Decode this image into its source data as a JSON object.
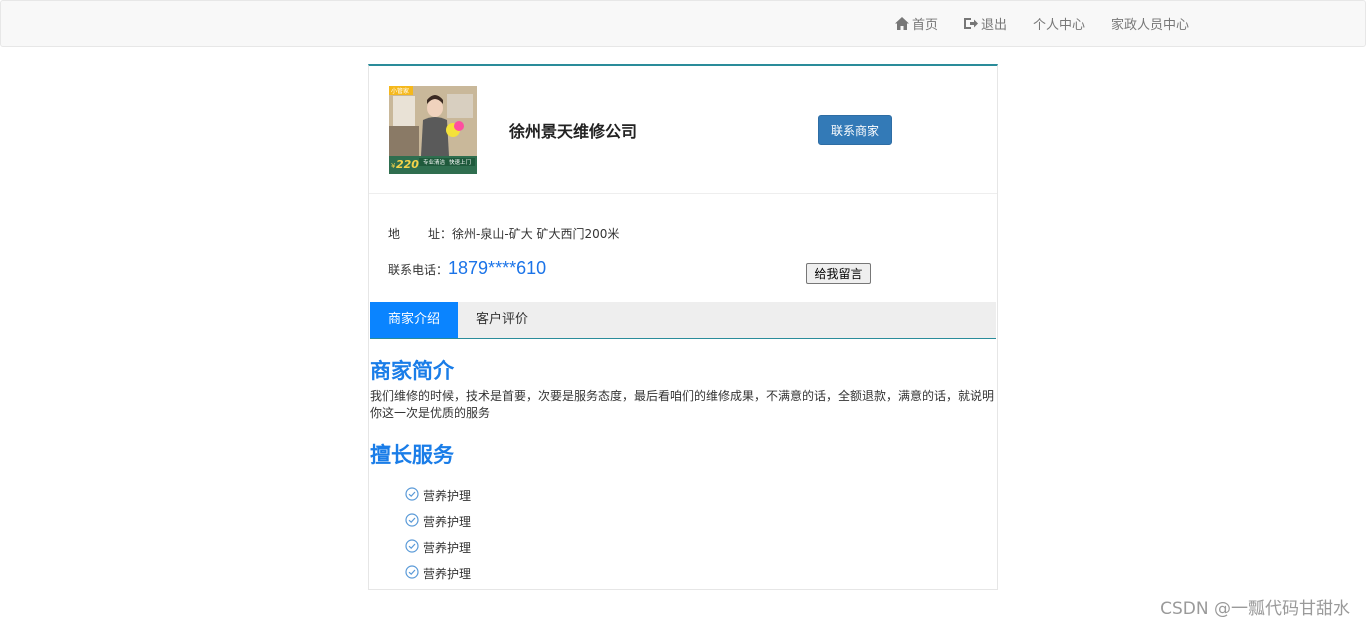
{
  "nav": {
    "home": "首页",
    "logout": "退出",
    "personal_center": "个人中心",
    "staff_center": "家政人员中心"
  },
  "company": {
    "name": "徐州景天维修公司",
    "contact_button": "联系商家",
    "address_label_1": "地",
    "address_label_2": "址：",
    "address": "徐州-泉山-矿大 矿大西门200米",
    "phone_label": "联系电话：",
    "phone": "1879****610",
    "message_button": "给我留言"
  },
  "thumb": {
    "badge": "小管家",
    "price": "220",
    "price_prefix": "¥",
    "caption_1": "专业清洁",
    "caption_2": "快速上门"
  },
  "tabs": [
    "商家介绍",
    "客户评价"
  ],
  "intro": {
    "title": "商家简介",
    "text": "我们维修的时候，技术是首要，次要是服务态度，最后看咱们的维修成果，不满意的话，全额退款，满意的话，就说明你这一次是优质的服务"
  },
  "services": {
    "title": "擅长服务",
    "items": [
      "营养护理",
      "营养护理",
      "营养护理",
      "营养护理"
    ]
  },
  "watermark": "CSDN @一瓢代码甘甜水",
  "colors": {
    "accent": "#0a84ff",
    "title_blue": "#1a7de8",
    "button_blue": "#337ab7",
    "card_top_border": "#2a8c9a"
  }
}
